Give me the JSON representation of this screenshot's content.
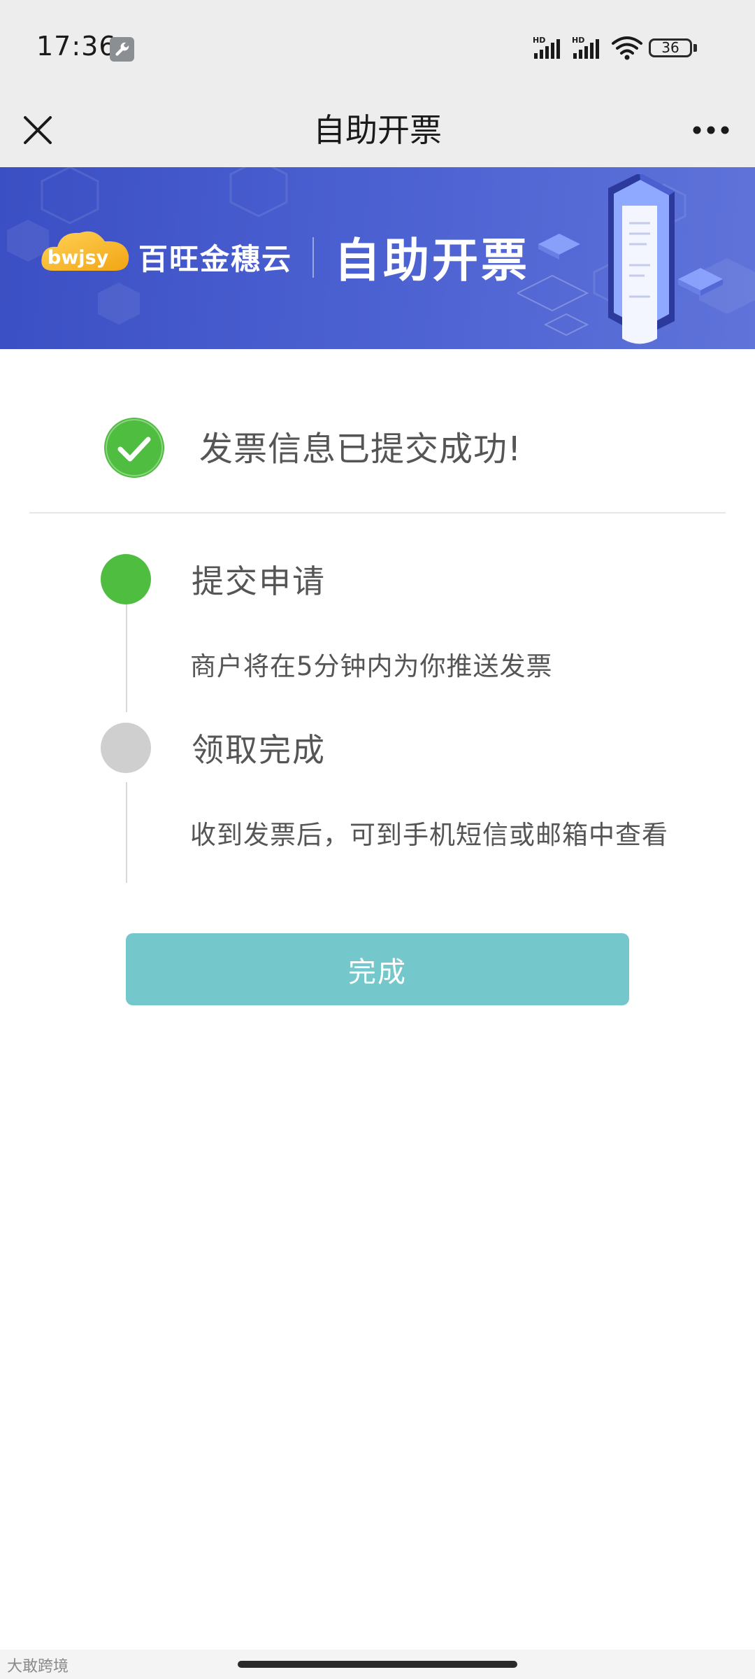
{
  "status_bar": {
    "time": "17:36",
    "battery": "36",
    "signal_label": "HD"
  },
  "nav": {
    "title": "自助开票"
  },
  "banner": {
    "brand_logo_text": "bwjsy",
    "brand_name": "百旺金穗云",
    "title": "自助开票",
    "accent_color": "#4a5fd0"
  },
  "success": {
    "message": "发票信息已提交成功!",
    "color": "#4fbd3f"
  },
  "steps": [
    {
      "title": "提交申请",
      "description": "商户将在5分钟内为你推送发票",
      "status": "active"
    },
    {
      "title": "领取完成",
      "description": "收到发票后，可到手机短信或邮箱中查看",
      "status": "inactive"
    }
  ],
  "done_button": {
    "label": "完成",
    "color": "#74c8cb"
  },
  "watermark": "大敢跨境"
}
